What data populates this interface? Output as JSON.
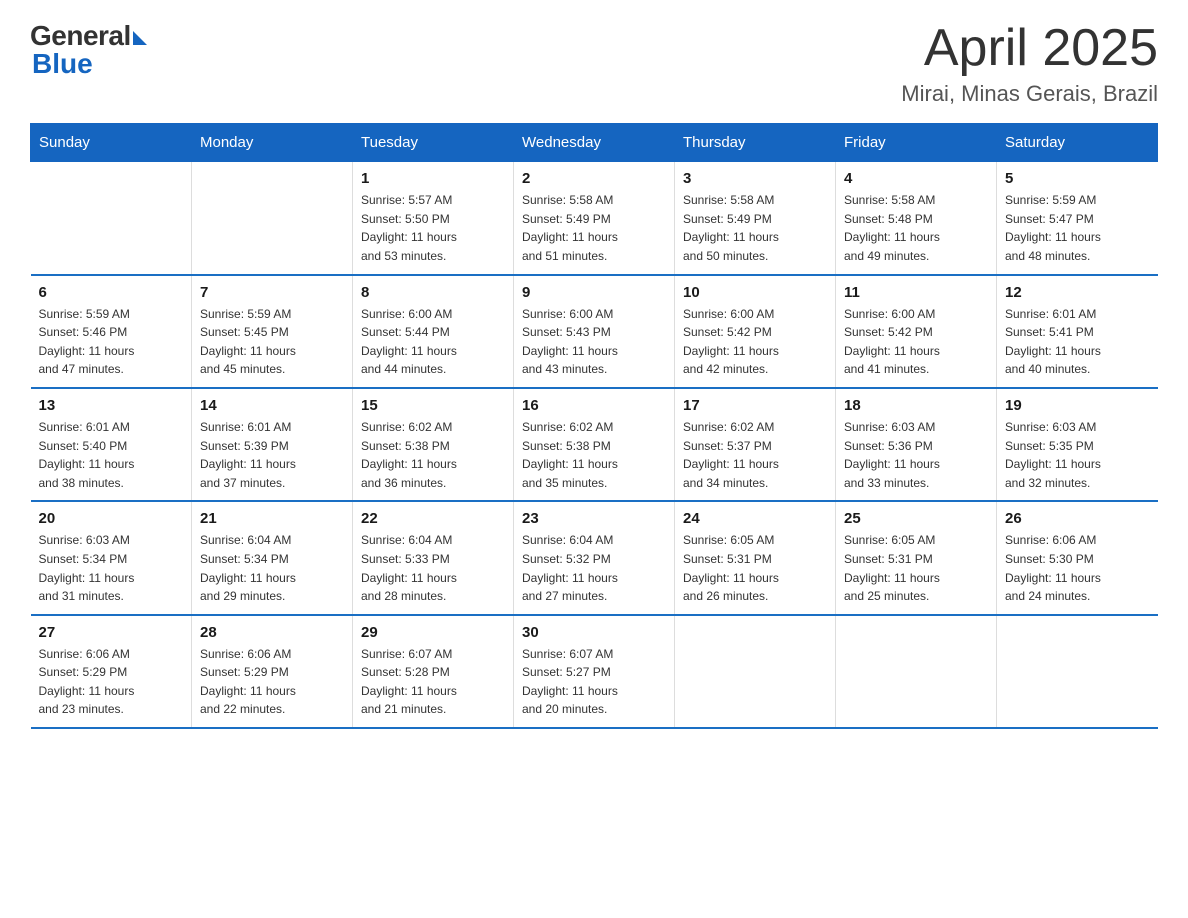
{
  "logo": {
    "general": "General",
    "blue": "Blue"
  },
  "title": "April 2025",
  "location": "Mirai, Minas Gerais, Brazil",
  "days_of_week": [
    "Sunday",
    "Monday",
    "Tuesday",
    "Wednesday",
    "Thursday",
    "Friday",
    "Saturday"
  ],
  "weeks": [
    [
      {
        "day": "",
        "info": ""
      },
      {
        "day": "",
        "info": ""
      },
      {
        "day": "1",
        "info": "Sunrise: 5:57 AM\nSunset: 5:50 PM\nDaylight: 11 hours\nand 53 minutes."
      },
      {
        "day": "2",
        "info": "Sunrise: 5:58 AM\nSunset: 5:49 PM\nDaylight: 11 hours\nand 51 minutes."
      },
      {
        "day": "3",
        "info": "Sunrise: 5:58 AM\nSunset: 5:49 PM\nDaylight: 11 hours\nand 50 minutes."
      },
      {
        "day": "4",
        "info": "Sunrise: 5:58 AM\nSunset: 5:48 PM\nDaylight: 11 hours\nand 49 minutes."
      },
      {
        "day": "5",
        "info": "Sunrise: 5:59 AM\nSunset: 5:47 PM\nDaylight: 11 hours\nand 48 minutes."
      }
    ],
    [
      {
        "day": "6",
        "info": "Sunrise: 5:59 AM\nSunset: 5:46 PM\nDaylight: 11 hours\nand 47 minutes."
      },
      {
        "day": "7",
        "info": "Sunrise: 5:59 AM\nSunset: 5:45 PM\nDaylight: 11 hours\nand 45 minutes."
      },
      {
        "day": "8",
        "info": "Sunrise: 6:00 AM\nSunset: 5:44 PM\nDaylight: 11 hours\nand 44 minutes."
      },
      {
        "day": "9",
        "info": "Sunrise: 6:00 AM\nSunset: 5:43 PM\nDaylight: 11 hours\nand 43 minutes."
      },
      {
        "day": "10",
        "info": "Sunrise: 6:00 AM\nSunset: 5:42 PM\nDaylight: 11 hours\nand 42 minutes."
      },
      {
        "day": "11",
        "info": "Sunrise: 6:00 AM\nSunset: 5:42 PM\nDaylight: 11 hours\nand 41 minutes."
      },
      {
        "day": "12",
        "info": "Sunrise: 6:01 AM\nSunset: 5:41 PM\nDaylight: 11 hours\nand 40 minutes."
      }
    ],
    [
      {
        "day": "13",
        "info": "Sunrise: 6:01 AM\nSunset: 5:40 PM\nDaylight: 11 hours\nand 38 minutes."
      },
      {
        "day": "14",
        "info": "Sunrise: 6:01 AM\nSunset: 5:39 PM\nDaylight: 11 hours\nand 37 minutes."
      },
      {
        "day": "15",
        "info": "Sunrise: 6:02 AM\nSunset: 5:38 PM\nDaylight: 11 hours\nand 36 minutes."
      },
      {
        "day": "16",
        "info": "Sunrise: 6:02 AM\nSunset: 5:38 PM\nDaylight: 11 hours\nand 35 minutes."
      },
      {
        "day": "17",
        "info": "Sunrise: 6:02 AM\nSunset: 5:37 PM\nDaylight: 11 hours\nand 34 minutes."
      },
      {
        "day": "18",
        "info": "Sunrise: 6:03 AM\nSunset: 5:36 PM\nDaylight: 11 hours\nand 33 minutes."
      },
      {
        "day": "19",
        "info": "Sunrise: 6:03 AM\nSunset: 5:35 PM\nDaylight: 11 hours\nand 32 minutes."
      }
    ],
    [
      {
        "day": "20",
        "info": "Sunrise: 6:03 AM\nSunset: 5:34 PM\nDaylight: 11 hours\nand 31 minutes."
      },
      {
        "day": "21",
        "info": "Sunrise: 6:04 AM\nSunset: 5:34 PM\nDaylight: 11 hours\nand 29 minutes."
      },
      {
        "day": "22",
        "info": "Sunrise: 6:04 AM\nSunset: 5:33 PM\nDaylight: 11 hours\nand 28 minutes."
      },
      {
        "day": "23",
        "info": "Sunrise: 6:04 AM\nSunset: 5:32 PM\nDaylight: 11 hours\nand 27 minutes."
      },
      {
        "day": "24",
        "info": "Sunrise: 6:05 AM\nSunset: 5:31 PM\nDaylight: 11 hours\nand 26 minutes."
      },
      {
        "day": "25",
        "info": "Sunrise: 6:05 AM\nSunset: 5:31 PM\nDaylight: 11 hours\nand 25 minutes."
      },
      {
        "day": "26",
        "info": "Sunrise: 6:06 AM\nSunset: 5:30 PM\nDaylight: 11 hours\nand 24 minutes."
      }
    ],
    [
      {
        "day": "27",
        "info": "Sunrise: 6:06 AM\nSunset: 5:29 PM\nDaylight: 11 hours\nand 23 minutes."
      },
      {
        "day": "28",
        "info": "Sunrise: 6:06 AM\nSunset: 5:29 PM\nDaylight: 11 hours\nand 22 minutes."
      },
      {
        "day": "29",
        "info": "Sunrise: 6:07 AM\nSunset: 5:28 PM\nDaylight: 11 hours\nand 21 minutes."
      },
      {
        "day": "30",
        "info": "Sunrise: 6:07 AM\nSunset: 5:27 PM\nDaylight: 11 hours\nand 20 minutes."
      },
      {
        "day": "",
        "info": ""
      },
      {
        "day": "",
        "info": ""
      },
      {
        "day": "",
        "info": ""
      }
    ]
  ]
}
